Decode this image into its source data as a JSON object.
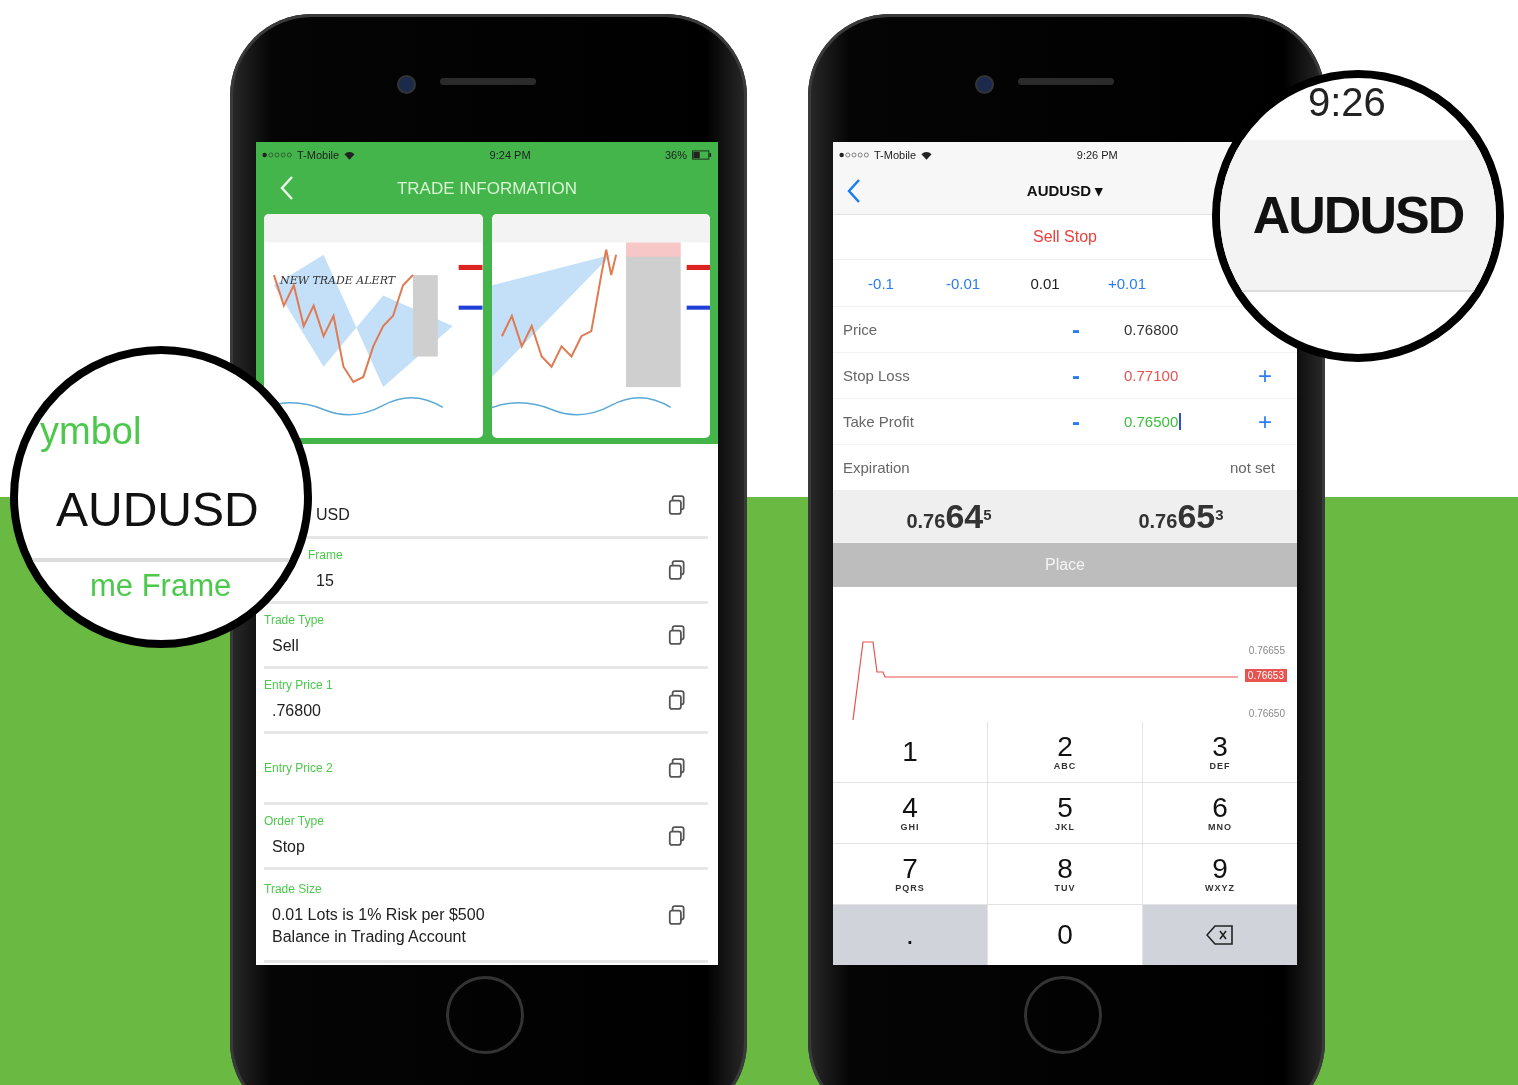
{
  "trade_info_phone": {
    "status_bar": {
      "carrier": "T-Mobile",
      "time": "9:24 PM",
      "battery": "36%"
    },
    "title": "TRADE INFORMATION",
    "chart_thumbnails": [
      {
        "kind": "bat_pattern",
        "caption": "NEW TRADE ALERT"
      },
      {
        "kind": "wedge_pattern"
      }
    ],
    "fields": [
      {
        "value": "USD",
        "cut": true
      },
      {
        "label": "Frame",
        "value": "15",
        "cut": true
      },
      {
        "label": "Trade Type",
        "value": "Sell",
        "cut": false
      },
      {
        "label": "Entry Price 1",
        "value": ".76800",
        "cut": false
      },
      {
        "label": "Entry Price 2",
        "cut": false
      },
      {
        "label": "Order Type",
        "value": "Stop",
        "cut": false
      },
      {
        "label": "Trade Size",
        "value": "0.01 Lots is 1% Risk per $500 Balance in Trading Account",
        "cut": false
      }
    ]
  },
  "order_phone": {
    "status_bar": {
      "carrier": "T-Mobile",
      "time": "9:26 PM"
    },
    "symbol": "AUDUSD ▾",
    "order_type": "Sell Stop",
    "steps": [
      {
        "label": "-0.1",
        "selected": false
      },
      {
        "label": "-0.01",
        "selected": false
      },
      {
        "label": "0.01",
        "selected": true
      },
      {
        "label": "+0.01",
        "selected": false
      }
    ],
    "rows": [
      {
        "kind": "price",
        "label": "Price",
        "minus": "-",
        "value": "0.76800",
        "focused": false
      },
      {
        "kind": "stop",
        "label": "Stop Loss",
        "minus": "-",
        "value": "0.77100",
        "plus": "+",
        "focused": false
      },
      {
        "kind": "profit",
        "label": "Take Profit",
        "minus": "-",
        "value": "0.76500",
        "plus": "+",
        "focused": true
      }
    ],
    "expiration": {
      "label": "Expiration",
      "value": "not set"
    },
    "quotes": [
      {
        "prefix": "0.76",
        "big": "64",
        "sup": "5"
      },
      {
        "prefix": "0.76",
        "big": "65",
        "sup": "3"
      }
    ],
    "place_button": {
      "label": "Place",
      "disabled": true
    },
    "tick_chart": {
      "upper": "0.76655",
      "current": "0.76653",
      "lower": "0.76650"
    },
    "keypad_rows": [
      [
        {
          "kind": "digit",
          "digit": "1"
        },
        {
          "kind": "digit",
          "digit": "2",
          "letters": "ABC"
        },
        {
          "kind": "digit",
          "digit": "3",
          "letters": "DEF"
        }
      ],
      [
        {
          "kind": "digit",
          "digit": "4",
          "letters": "GHI"
        },
        {
          "kind": "digit",
          "digit": "5",
          "letters": "JKL"
        },
        {
          "kind": "digit",
          "digit": "6",
          "letters": "MNO"
        }
      ],
      [
        {
          "kind": "digit",
          "digit": "7",
          "letters": "PQRS"
        },
        {
          "kind": "digit",
          "digit": "8",
          "letters": "TUV"
        },
        {
          "kind": "digit",
          "digit": "9",
          "letters": "WXYZ"
        }
      ],
      [
        {
          "kind": "symbol",
          "digit": "."
        },
        {
          "kind": "digit",
          "digit": "0"
        },
        {
          "kind": "backspace"
        }
      ]
    ]
  },
  "magnifier_left": {
    "label_top": "ymbol",
    "value": "AUDUSD",
    "label_bottom": "me Frame"
  },
  "magnifier_right": {
    "time": "9:26",
    "symbol": "AUDUSD"
  }
}
